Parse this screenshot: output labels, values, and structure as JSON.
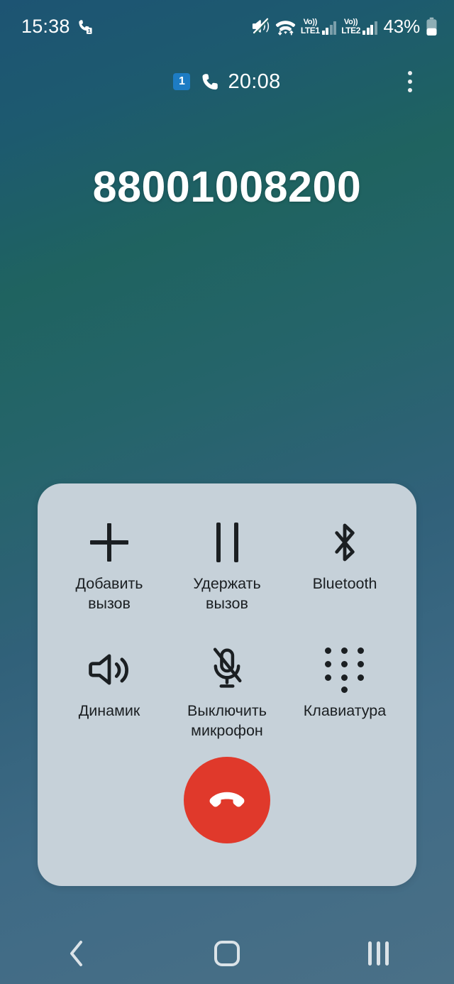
{
  "status_bar": {
    "clock": "15:38",
    "call_forward_icon": "call-forwarding-icon",
    "mute_icon": "volume-mute-icon",
    "wifi_icon": "wifi-icon",
    "sim1_label_top": "Vo))",
    "sim1_label_bottom": "LTE1",
    "sim2_label_top": "Vo))",
    "sim2_label_bottom": "LTE2",
    "battery_percent": "43%",
    "battery_icon": "battery-icon"
  },
  "call_header": {
    "sim_badge": "1",
    "handset_icon": "phone-handset-icon",
    "duration": "20:08",
    "more_menu_icon": "more-vertical-icon"
  },
  "call": {
    "phone_number": "88001008200"
  },
  "controls": {
    "buttons": [
      {
        "label": "Добавить\nвызов",
        "name": "add-call-button",
        "icon": "plus-icon"
      },
      {
        "label": "Удержать\nвызов",
        "name": "hold-call-button",
        "icon": "pause-icon"
      },
      {
        "label": "Bluetooth",
        "name": "bluetooth-button",
        "icon": "bluetooth-icon"
      },
      {
        "label": "Динамик",
        "name": "speaker-button",
        "icon": "speaker-icon"
      },
      {
        "label": "Выключить\nмикрофон",
        "name": "mute-microphone-button",
        "icon": "microphone-off-icon"
      },
      {
        "label": "Клавиатура",
        "name": "keypad-button",
        "icon": "dialpad-icon"
      }
    ],
    "end_call_icon": "end-call-handset-icon"
  },
  "nav_bar": {
    "back_icon": "back-chevron-icon",
    "home_icon": "home-square-icon",
    "recents_icon": "recents-bars-icon"
  },
  "colors": {
    "panel_background": "#C6D1D9",
    "end_call_red": "#E0392B",
    "sim_badge_blue": "#1D7CC4",
    "gradient_top_left": "#1D5473",
    "gradient_top_right": "#1F6360",
    "gradient_bottom": "#4A7087",
    "icon_dark": "#1B1F22",
    "text_white": "#FFFFFF"
  }
}
